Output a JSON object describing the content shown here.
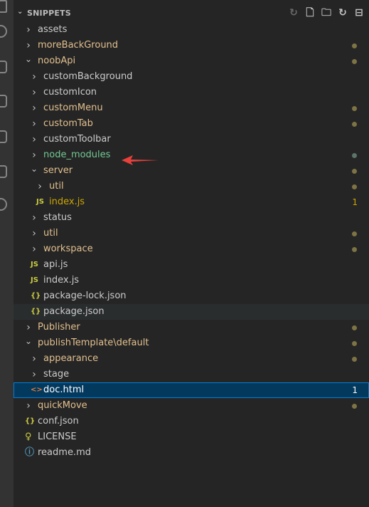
{
  "explorer": {
    "title": "SNIPPETS",
    "actions": [
      "history-icon",
      "new-file-icon",
      "new-folder-icon",
      "refresh-icon",
      "collapse-all-icon"
    ]
  },
  "tree": [
    {
      "label": "assets",
      "type": "folder",
      "expanded": false,
      "depth": 0,
      "state": "normal"
    },
    {
      "label": "moreBackGround",
      "type": "folder",
      "expanded": false,
      "depth": 0,
      "state": "modified",
      "dot": true
    },
    {
      "label": "noobApi",
      "type": "folder",
      "expanded": true,
      "depth": 0,
      "state": "modified",
      "dot": true
    },
    {
      "label": "customBackground",
      "type": "folder",
      "expanded": false,
      "depth": 1,
      "state": "normal"
    },
    {
      "label": "customIcon",
      "type": "folder",
      "expanded": false,
      "depth": 1,
      "state": "normal"
    },
    {
      "label": "customMenu",
      "type": "folder",
      "expanded": false,
      "depth": 1,
      "state": "modified",
      "dot": true
    },
    {
      "label": "customTab",
      "type": "folder",
      "expanded": false,
      "depth": 1,
      "state": "modified",
      "dot": true
    },
    {
      "label": "customToolbar",
      "type": "folder",
      "expanded": false,
      "depth": 1,
      "state": "normal"
    },
    {
      "label": "node_modules",
      "type": "folder",
      "expanded": false,
      "depth": 1,
      "state": "untracked",
      "dot": true
    },
    {
      "label": "server",
      "type": "folder",
      "expanded": true,
      "depth": 1,
      "state": "modified",
      "dot": true
    },
    {
      "label": "util",
      "type": "folder",
      "expanded": false,
      "depth": 2,
      "state": "modified",
      "dot": true
    },
    {
      "label": "index.js",
      "type": "js",
      "depth": 2,
      "state": "warning",
      "badge": "1"
    },
    {
      "label": "status",
      "type": "folder",
      "expanded": false,
      "depth": 1,
      "state": "normal"
    },
    {
      "label": "util",
      "type": "folder",
      "expanded": false,
      "depth": 1,
      "state": "modified",
      "dot": true
    },
    {
      "label": "workspace",
      "type": "folder",
      "expanded": false,
      "depth": 1,
      "state": "modified",
      "dot": true
    },
    {
      "label": "api.js",
      "type": "js",
      "depth": 1,
      "state": "normal"
    },
    {
      "label": "index.js",
      "type": "js",
      "depth": 1,
      "state": "normal"
    },
    {
      "label": "package-lock.json",
      "type": "json",
      "depth": 1,
      "state": "normal"
    },
    {
      "label": "package.json",
      "type": "json",
      "depth": 1,
      "state": "normal",
      "hover": true
    },
    {
      "label": "Publisher",
      "type": "folder",
      "expanded": false,
      "depth": 0,
      "state": "modified",
      "dot": true
    },
    {
      "label": "publishTemplate\\default",
      "type": "folder",
      "expanded": true,
      "depth": 0,
      "state": "modified",
      "dot": true
    },
    {
      "label": "appearance",
      "type": "folder",
      "expanded": false,
      "depth": 1,
      "state": "modified",
      "dot": true
    },
    {
      "label": "stage",
      "type": "folder",
      "expanded": false,
      "depth": 1,
      "state": "normal"
    },
    {
      "label": "doc.html",
      "type": "html",
      "depth": 1,
      "state": "selected",
      "badge": "1"
    },
    {
      "label": "quickMove",
      "type": "folder",
      "expanded": false,
      "depth": 0,
      "state": "modified",
      "dot": true
    },
    {
      "label": "conf.json",
      "type": "json",
      "depth": 0,
      "state": "normal"
    },
    {
      "label": "LICENSE",
      "type": "license",
      "depth": 0,
      "state": "normal"
    },
    {
      "label": "readme.md",
      "type": "info",
      "depth": 0,
      "state": "normal"
    }
  ],
  "colors": {
    "background": "#252526",
    "modified": "#e2c08d",
    "untracked": "#73c991",
    "warning": "#cca700",
    "selection": "#04395e",
    "selection_border": "#007fd4",
    "annotation_arrow": "#e8413b"
  }
}
